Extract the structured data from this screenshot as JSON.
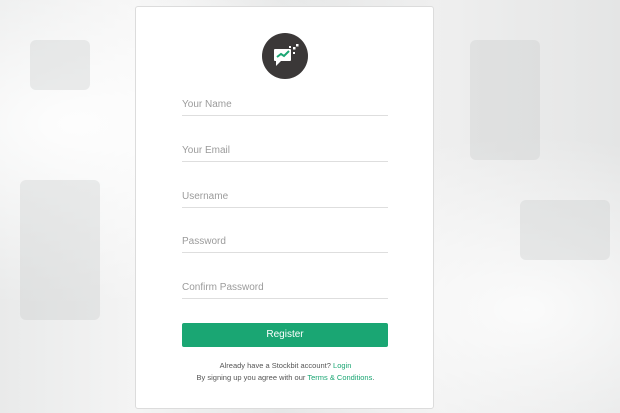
{
  "form": {
    "name_placeholder": "Your Name",
    "email_placeholder": "Your Email",
    "username_placeholder": "Username",
    "password_placeholder": "Password",
    "confirm_password_placeholder": "Confirm Password",
    "register_label": "Register"
  },
  "footer": {
    "login_prompt": "Already have a Stockbit account?",
    "login_link": "Login",
    "terms_prompt": "By signing up you agree with our",
    "terms_link": "Terms & Conditions",
    "terms_suffix": "."
  },
  "logo": {
    "icon": "stockbit-logo-icon"
  },
  "colors": {
    "accent": "#1aa673",
    "logo_bg": "#3b3838",
    "card_bg": "#ffffff"
  }
}
